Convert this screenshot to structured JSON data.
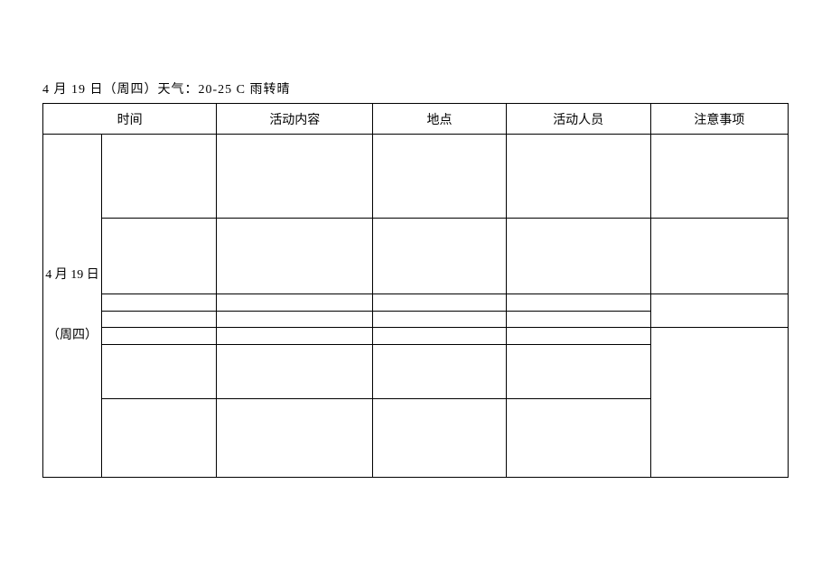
{
  "heading": "4 月 19 日（周四）天气：20-25 C 雨转晴",
  "headers": {
    "time": "时间",
    "activity": "活动内容",
    "location": "地点",
    "personnel": "活动人员",
    "notes": "注意事项"
  },
  "date_cell": {
    "date": "4 月 19 日",
    "day": "（周四）"
  },
  "rows": [
    {
      "time": "",
      "activity": "",
      "location": "",
      "personnel": "",
      "notes": ""
    },
    {
      "time": "",
      "activity": "",
      "location": "",
      "personnel": "",
      "notes": ""
    },
    {
      "time": "",
      "activity": "",
      "location": "",
      "personnel": ""
    },
    {
      "time": "",
      "activity": "",
      "location": "",
      "personnel": "",
      "notes": ""
    },
    {
      "time": "",
      "activity": "",
      "location": "",
      "personnel": ""
    },
    {
      "time": "",
      "activity": "",
      "location": "",
      "personnel": "",
      "notes": ""
    },
    {
      "time": "",
      "activity": "",
      "location": "",
      "personnel": "",
      "notes": ""
    }
  ]
}
